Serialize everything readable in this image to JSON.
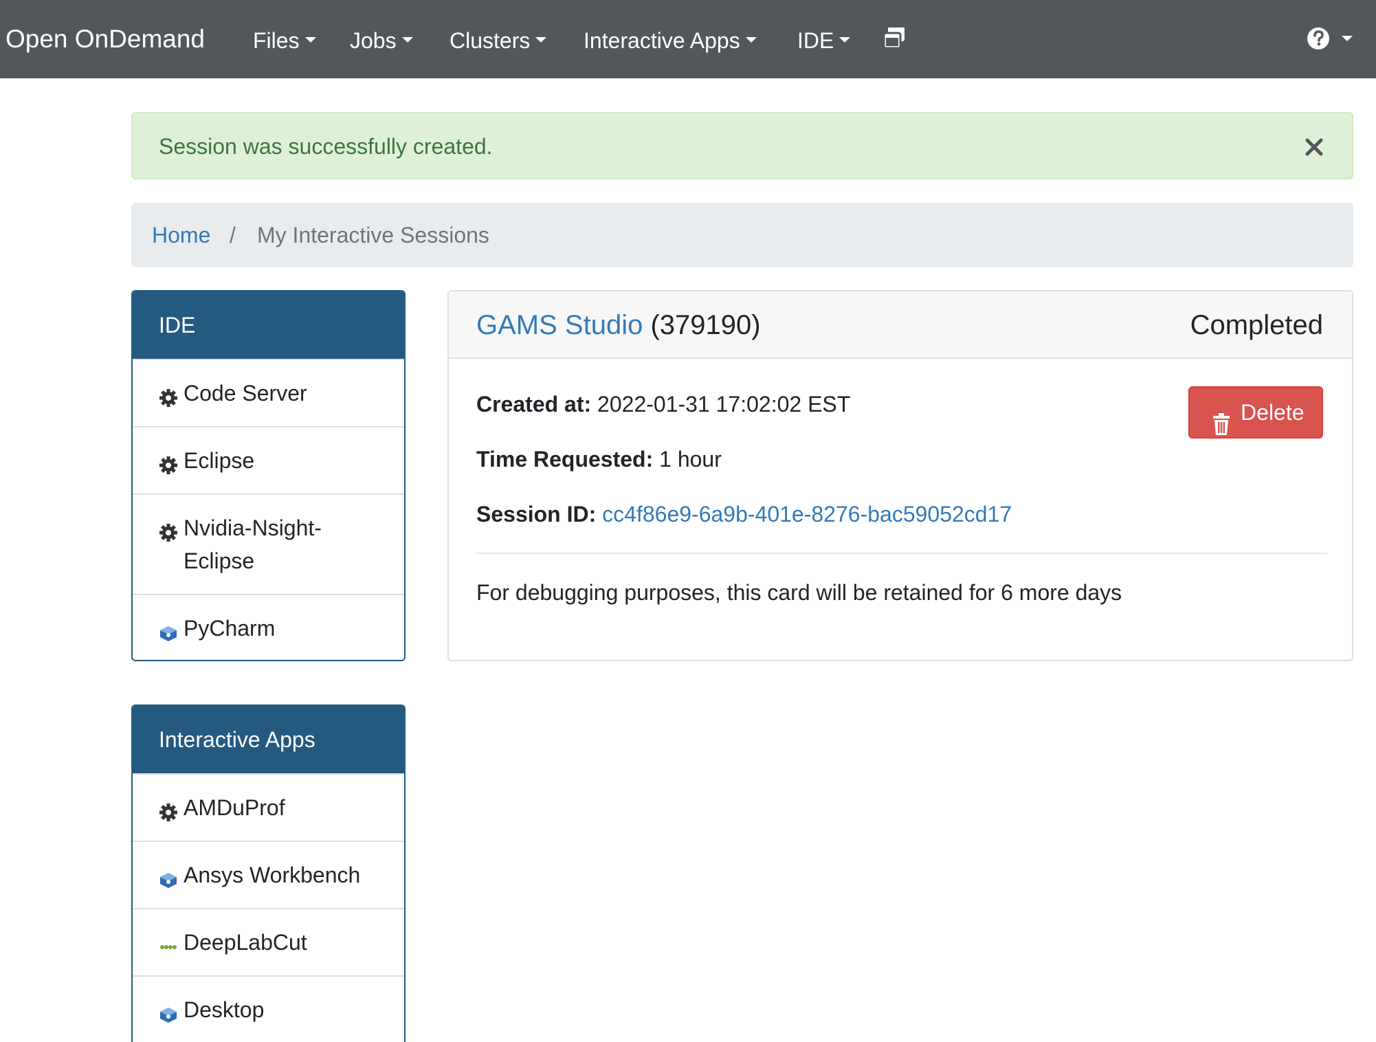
{
  "navbar": {
    "brand": "Open OnDemand",
    "menus": [
      "Files",
      "Jobs",
      "Clusters",
      "Interactive Apps",
      "IDE"
    ],
    "icons": [
      "windows-icon",
      "help-icon"
    ],
    "background": "#53575c"
  },
  "alert": {
    "message": "Session was successfully created.",
    "close_icon": "close-icon"
  },
  "breadcrumb": {
    "home": "Home",
    "separator": "/",
    "current": "My Interactive Sessions"
  },
  "sidebar": {
    "ide": {
      "title": "IDE",
      "items": [
        {
          "label": "Code Server",
          "icon": "gear-icon"
        },
        {
          "label": "Eclipse",
          "icon": "gear-icon"
        },
        {
          "label": "Nvidia-Nsight-Eclipse",
          "icon": "gear-icon"
        },
        {
          "label": "PyCharm",
          "icon": "app-logo-icon"
        }
      ]
    },
    "interactive_apps": {
      "title": "Interactive Apps",
      "items": [
        {
          "label": "AMDuProf",
          "icon": "gear-icon"
        },
        {
          "label": "Ansys Workbench",
          "icon": "app-logo-icon"
        },
        {
          "label": "DeepLabCut",
          "icon": "ocis-logo-icon"
        },
        {
          "label": "Desktop",
          "icon": "app-logo-icon"
        }
      ]
    },
    "header_color": "#245a80"
  },
  "session": {
    "app_name": "GAMS Studio",
    "job_id": "(379190)",
    "status": "Completed",
    "created_label": "Created at:",
    "created_value": "2022-01-31 17:02:02 EST",
    "time_label": "Time Requested:",
    "time_value": "1 hour",
    "id_label": "Session ID:",
    "id_value": "cc4f86e9-6a9b-401e-8276-bac59052cd17",
    "note": "For debugging purposes, this card will be retained for 6 more days",
    "delete_label": "Delete",
    "delete_color": "#d9534f"
  }
}
